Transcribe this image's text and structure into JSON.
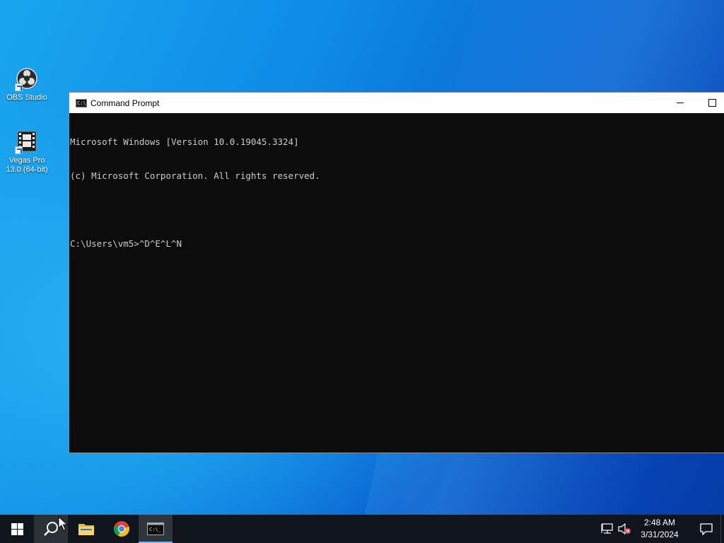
{
  "desktop": {
    "icons": [
      {
        "label": "OBS Studio",
        "icon": "obs-studio-icon"
      },
      {
        "label": "Vegas Pro 13.0 (64-bit)",
        "icon": "vegas-pro-icon"
      }
    ]
  },
  "window": {
    "title": "Command Prompt",
    "icon": "cmd-icon",
    "controls": {
      "minimize": "minimize-icon",
      "maximize": "maximize-icon"
    },
    "console_lines": [
      "Microsoft Windows [Version 10.0.19045.3324]",
      "(c) Microsoft Corporation. All rights reserved.",
      "",
      "C:\\Users\\vm5>^D^E^L^N"
    ],
    "colors": {
      "background": "#0c0c0c",
      "text": "#cccccc"
    }
  },
  "taskbar": {
    "items": [
      {
        "name": "start",
        "icon": "windows-logo-icon"
      },
      {
        "name": "search",
        "icon": "search-icon"
      },
      {
        "name": "file-explorer",
        "icon": "folder-icon"
      },
      {
        "name": "chrome",
        "icon": "chrome-icon"
      },
      {
        "name": "command-prompt",
        "icon": "cmd-icon",
        "active": true
      }
    ],
    "tray": {
      "icons": [
        "network-icon",
        "volume-muted-icon"
      ],
      "time": "2:48 AM",
      "date": "3/31/2024",
      "notification_icon": "notification-icon"
    },
    "accent": "#7fb4ea"
  }
}
